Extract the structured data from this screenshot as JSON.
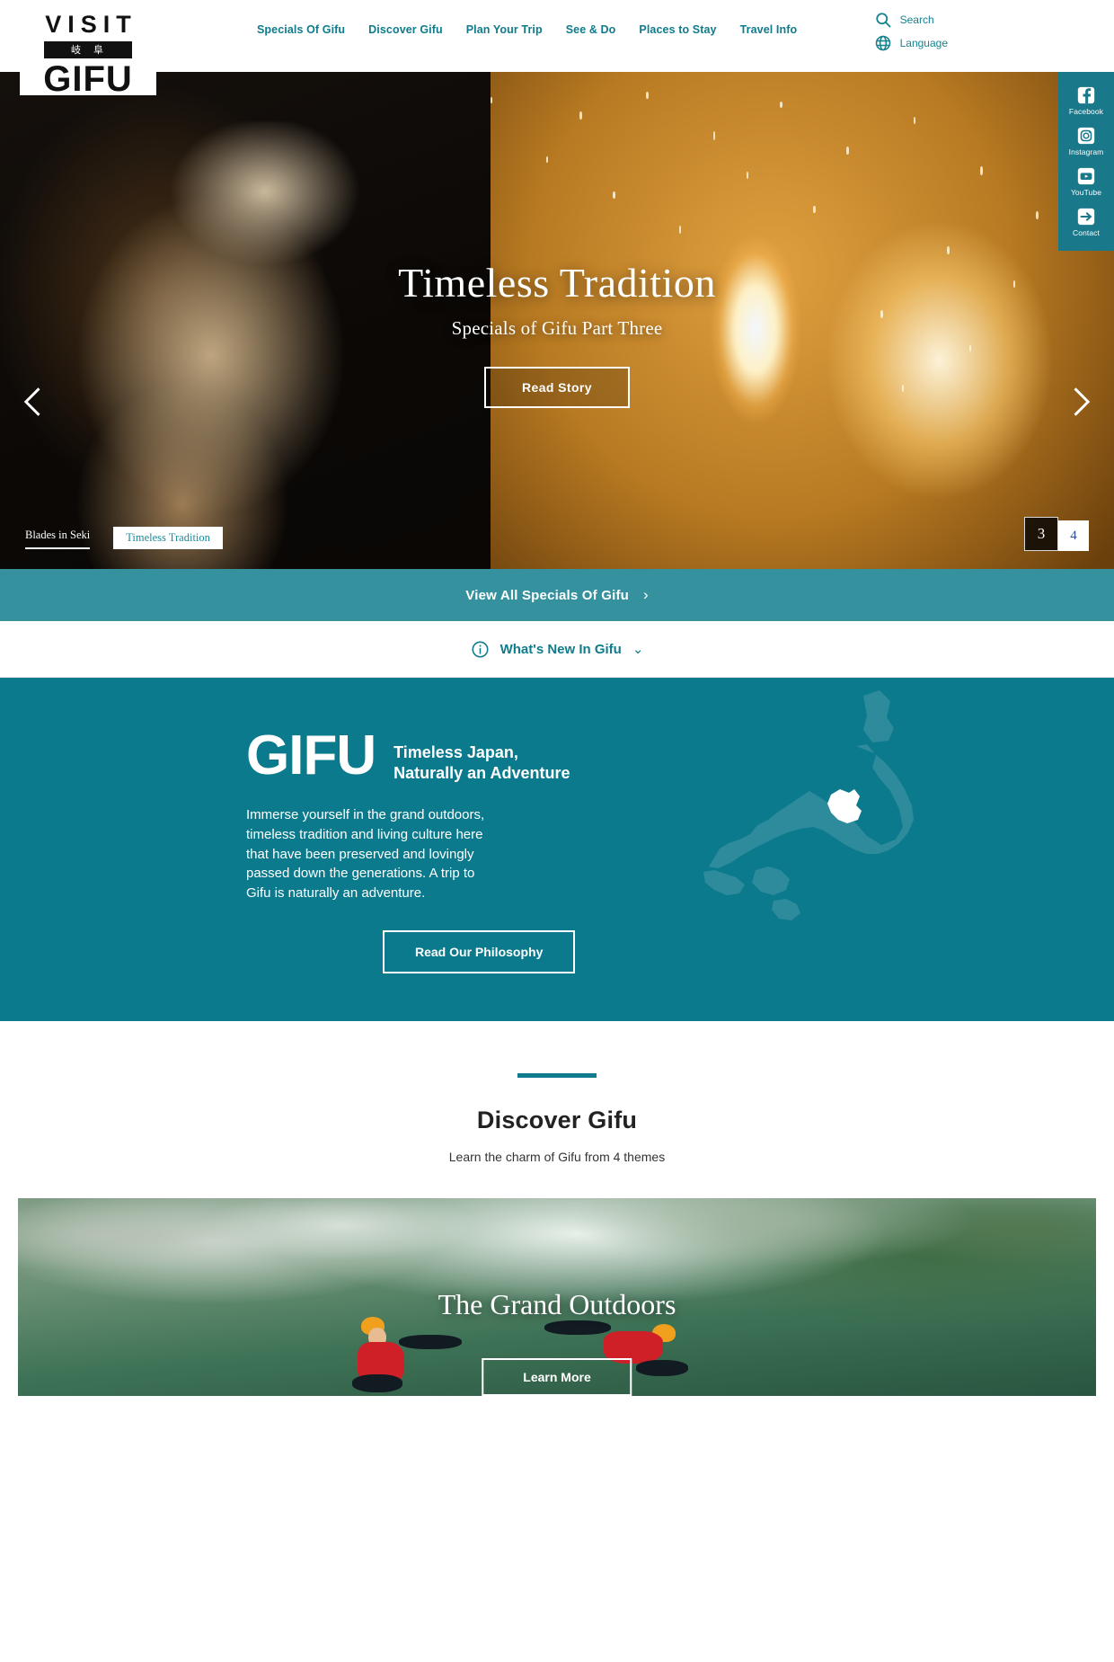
{
  "header": {
    "logo": {
      "top": "VISIT",
      "kanji": "岐阜",
      "bottom": "GIFU"
    },
    "nav": [
      {
        "label": "Specials Of Gifu"
      },
      {
        "label": "Discover Gifu"
      },
      {
        "label": "Plan Your Trip"
      },
      {
        "label": "See & Do"
      },
      {
        "label": "Places to Stay"
      },
      {
        "label": "Travel Info"
      }
    ],
    "tools": [
      {
        "icon": "search-icon",
        "label": "Search"
      },
      {
        "icon": "globe-icon",
        "label": "Language"
      }
    ]
  },
  "social": {
    "items": [
      {
        "icon": "facebook-icon",
        "label": "Facebook"
      },
      {
        "icon": "instagram-icon",
        "label": "Instagram"
      },
      {
        "icon": "youtube-icon",
        "label": "YouTube"
      },
      {
        "icon": "contact-arrow-icon",
        "label": "Contact"
      }
    ]
  },
  "hero": {
    "title": "Timeless Tradition",
    "subtitle": "Specials of Gifu Part Three",
    "button": "Read Story",
    "prev_icon": "chevron-left-icon",
    "next_icon": "chevron-right-icon",
    "captions": [
      {
        "label": "Blades in Seki",
        "active": false
      },
      {
        "label": "Timeless Tradition",
        "active": true
      }
    ],
    "counter": {
      "current": "3",
      "total": "4"
    }
  },
  "specials_bar": {
    "label": "View All Specials Of Gifu",
    "chevron": "›"
  },
  "whats_new": {
    "icon": "info-circle-icon",
    "label": "What's New In Gifu",
    "chevron": "⌄"
  },
  "gifu_section": {
    "word": "GIFU",
    "tagline_line1": "Timeless Japan,",
    "tagline_line2": "Naturally an Adventure",
    "paragraph": "Immerse yourself in the grand outdoors, timeless tradition and living culture here that have been preserved and lovingly passed down the generations. A trip to Gifu is naturally an adventure.",
    "button": "Read Our Philosophy",
    "map_alt": "japan-map-gifu-highlighted"
  },
  "discover": {
    "title": "Discover Gifu",
    "subtitle": "Learn the charm of Gifu from 4 themes",
    "cards": [
      {
        "title": "The Grand Outdoors",
        "button": "Learn More"
      }
    ]
  },
  "colors": {
    "teal_brand": "#0f7b8c",
    "teal_bar": "#35919e",
    "teal_section": "#0c7a8d",
    "teal_rail": "#19788a",
    "text_dark": "#222222"
  }
}
